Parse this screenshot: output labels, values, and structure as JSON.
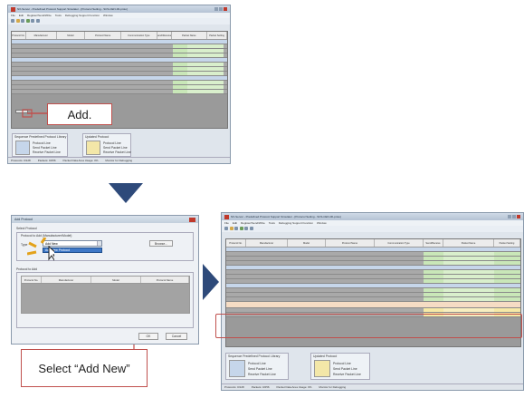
{
  "app_title": "NX-Server - Predefined Protocol Support Simulator - [Protocol Setting - SCS-CEN-00-proto]",
  "menu": [
    "File",
    "Edit",
    "Register/Send/Write",
    "Tools",
    "Debugging Support Function",
    "Window"
  ],
  "table_headers": [
    "Protocol No.",
    "Manufacturer",
    "Model",
    "Protocol Name",
    "Communication Type",
    "Send/Receive",
    "Packet Name",
    "Packet Setting"
  ],
  "legend_title_1": "Sequence Predefined Protocol Library",
  "legend_items_1": [
    "Protocol Line",
    "Send Packet Line",
    "Receive Packet Line"
  ],
  "legend_title_2": "Updated Protocol",
  "legend_items_2": [
    "Protocol Line",
    "Send Packet Line",
    "Receive Packet Line"
  ],
  "status": [
    "Protocols: 0/128",
    "Packets: 0/256",
    "Packet Data Area Usage: 0%",
    "Monitor for Debugging"
  ],
  "callout_add": "Add.",
  "dialog": {
    "title": "Add Protocol",
    "group_label": "Select Protocol",
    "sub_label": "Protocol to Add (Manufacturer/Model)",
    "type_label": "Type",
    "combo_value": "Add New",
    "add_new_item": "Add New Protocol",
    "browse_label": "Browse...",
    "list_label": "Protocol to Add",
    "headers": [
      "Protocol No.",
      "Manufacturer",
      "Model",
      "Protocol Name"
    ],
    "ok": "OK",
    "cancel": "Cancel"
  },
  "callout_select": "Select “Add New”",
  "colors": {
    "callout_border": "#c0504d",
    "arrow": "#2e4a7a",
    "protocol_row": "#c6d6ea",
    "packet_cell": "#c9e7b8",
    "selected_row": "#f5dcc4"
  }
}
